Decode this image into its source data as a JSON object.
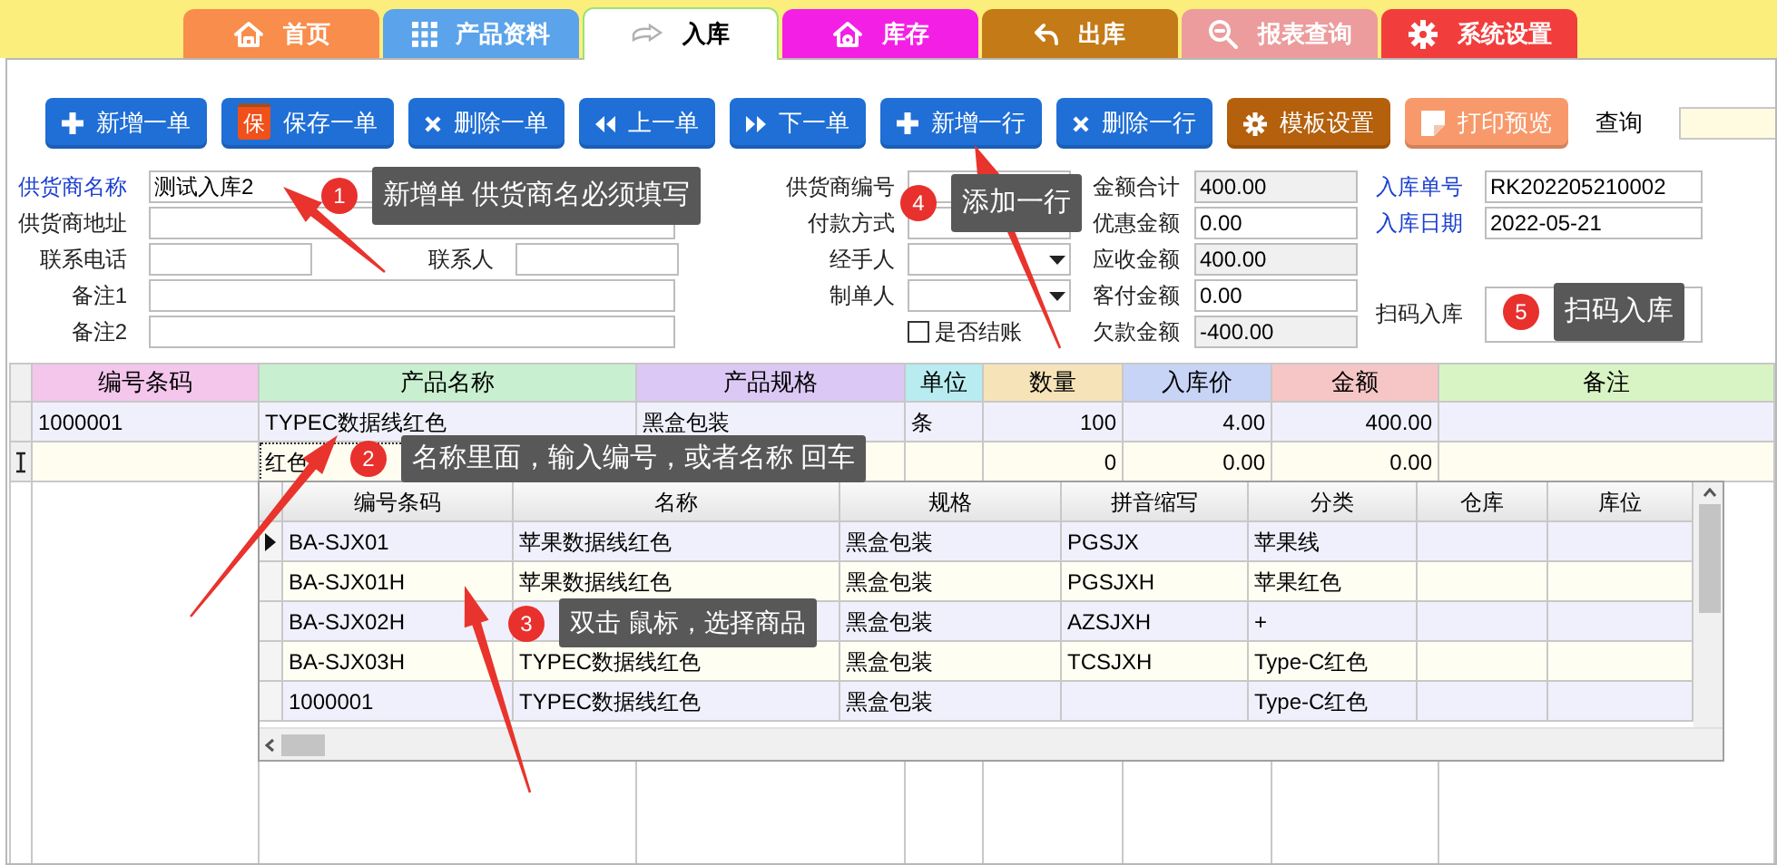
{
  "tabs": [
    {
      "label": "首页",
      "color": "#f98d4c",
      "selected": false
    },
    {
      "label": "产品资料",
      "color": "#5ba3ea",
      "selected": false
    },
    {
      "label": "入库",
      "color": "#ffffff",
      "selected": true
    },
    {
      "label": "库存",
      "color": "#f41fe4",
      "selected": false
    },
    {
      "label": "出库",
      "color": "#c47a16",
      "selected": false
    },
    {
      "label": "报表查询",
      "color": "#ec9c9c",
      "selected": false
    },
    {
      "label": "系统设置",
      "color": "#f23d3d",
      "selected": false
    }
  ],
  "toolbar": {
    "buttons": [
      {
        "label": "新增一单",
        "color": "#1f6fd6"
      },
      {
        "label": "保存一单",
        "badge": "保",
        "color": "#1f6fd6"
      },
      {
        "label": "删除一单",
        "color": "#1f6fd6"
      },
      {
        "label": "上一单",
        "color": "#1f6fd6"
      },
      {
        "label": "下一单",
        "color": "#1f6fd6"
      },
      {
        "label": "新增一行",
        "color": "#1f6fd6"
      },
      {
        "label": "删除一行",
        "color": "#1f6fd6"
      },
      {
        "label": "模板设置",
        "color": "#b4600c"
      },
      {
        "label": "打印预览",
        "color": "#f8996b"
      }
    ],
    "search": {
      "label": "查询"
    }
  },
  "form": {
    "columns": [
      [
        {
          "kind": "text",
          "label": "供货商名称",
          "required": true,
          "value": "测试入库2"
        },
        {
          "kind": "text",
          "label": "供货商地址",
          "required": false
        },
        {
          "kind": "pair",
          "fields": [
            {
              "label": "联系电话",
              "required": false
            },
            {
              "label": "联系人",
              "required": false
            }
          ]
        },
        {
          "kind": "text",
          "label": "备注1",
          "required": false
        },
        {
          "kind": "text",
          "label": "备注2",
          "required": false
        }
      ],
      [
        {
          "kind": "text",
          "label": "供货商编号",
          "required": false
        },
        {
          "kind": "select",
          "label": "付款方式",
          "required": false
        },
        {
          "kind": "select",
          "label": "经手人",
          "required": false
        },
        {
          "kind": "select",
          "label": "制单人",
          "required": false
        },
        {
          "kind": "checkbox",
          "label": "是否结账",
          "checked": false
        }
      ],
      [
        {
          "kind": "readonly",
          "label": "金额合计",
          "required": false,
          "value": "400.00"
        },
        {
          "kind": "text",
          "label": "优惠金额",
          "required": false,
          "value": "0.00"
        },
        {
          "kind": "readonly",
          "label": "应收金额",
          "required": false,
          "value": "400.00"
        },
        {
          "kind": "text",
          "label": "客付金额",
          "required": false,
          "value": "0.00"
        },
        {
          "kind": "readonly",
          "label": "欠款金额",
          "required": false,
          "value": "-400.00"
        }
      ],
      [
        {
          "kind": "text",
          "label": "入库单号",
          "required": true,
          "value": "RK202205210002"
        },
        {
          "kind": "text",
          "label": "入库日期",
          "required": true,
          "value": "2022-05-21"
        },
        {
          "kind": "blank"
        },
        {
          "kind": "tall",
          "label": "扫码入库",
          "required": false
        }
      ]
    ]
  },
  "grid": {
    "columns": [
      {
        "label": "编号条码",
        "color": "#f4c6ec"
      },
      {
        "label": "产品名称",
        "color": "#c8f0d0"
      },
      {
        "label": "产品规格",
        "color": "#dcc8f4"
      },
      {
        "label": "单位",
        "color": "#b8ecf0"
      },
      {
        "label": "数量",
        "color": "#f6e4b8"
      },
      {
        "label": "入库价",
        "color": "#c8d4f6"
      },
      {
        "label": "金额",
        "color": "#f6c6c6"
      },
      {
        "label": "备注",
        "color": "#d8f4c4"
      }
    ],
    "rows": [
      {
        "editing": false,
        "cells": [
          "1000001",
          "TYPEC数据线红色",
          "黑盒包装",
          "条",
          "100",
          "4.00",
          "400.00",
          null
        ]
      },
      {
        "editing": true,
        "cells": [
          null,
          "红色",
          null,
          null,
          "0",
          "0.00",
          "0.00",
          null
        ]
      }
    ]
  },
  "lookup": {
    "columns": [
      "编号条码",
      "名称",
      "规格",
      "拼音缩写",
      "分类",
      "仓库",
      "库位"
    ],
    "rows": [
      {
        "selected": true,
        "cells": [
          "BA-SJX01",
          "苹果数据线红色",
          "黑盒包装",
          "PGSJX",
          "苹果线",
          null,
          null
        ]
      },
      {
        "selected": false,
        "cells": [
          "BA-SJX01H",
          "苹果数据线红色",
          "黑盒包装",
          "PGSJXH",
          "苹果红色",
          null,
          null
        ]
      },
      {
        "selected": false,
        "cells": [
          "BA-SJX02H",
          null,
          "黑盒包装",
          "AZSJXH",
          "+",
          null,
          null
        ]
      },
      {
        "selected": false,
        "cells": [
          "BA-SJX03H",
          "TYPEC数据线红色",
          "黑盒包装",
          "TCSJXH",
          "Type-C红色",
          null,
          null
        ]
      },
      {
        "selected": false,
        "cells": [
          "1000001",
          "TYPEC数据线红色",
          "黑盒包装",
          null,
          "Type-C红色",
          null,
          null
        ]
      }
    ]
  },
  "callouts": [
    {
      "number": "1",
      "text": "新增单 供货商名必须填写"
    },
    {
      "number": "4",
      "text": "添加一行"
    },
    {
      "number": "5",
      "text": "扫码入库"
    },
    {
      "number": "2",
      "text": "名称里面，输入编号，或者名称 回车"
    },
    {
      "number": "3",
      "text": "双击 鼠标，选择商品"
    }
  ]
}
